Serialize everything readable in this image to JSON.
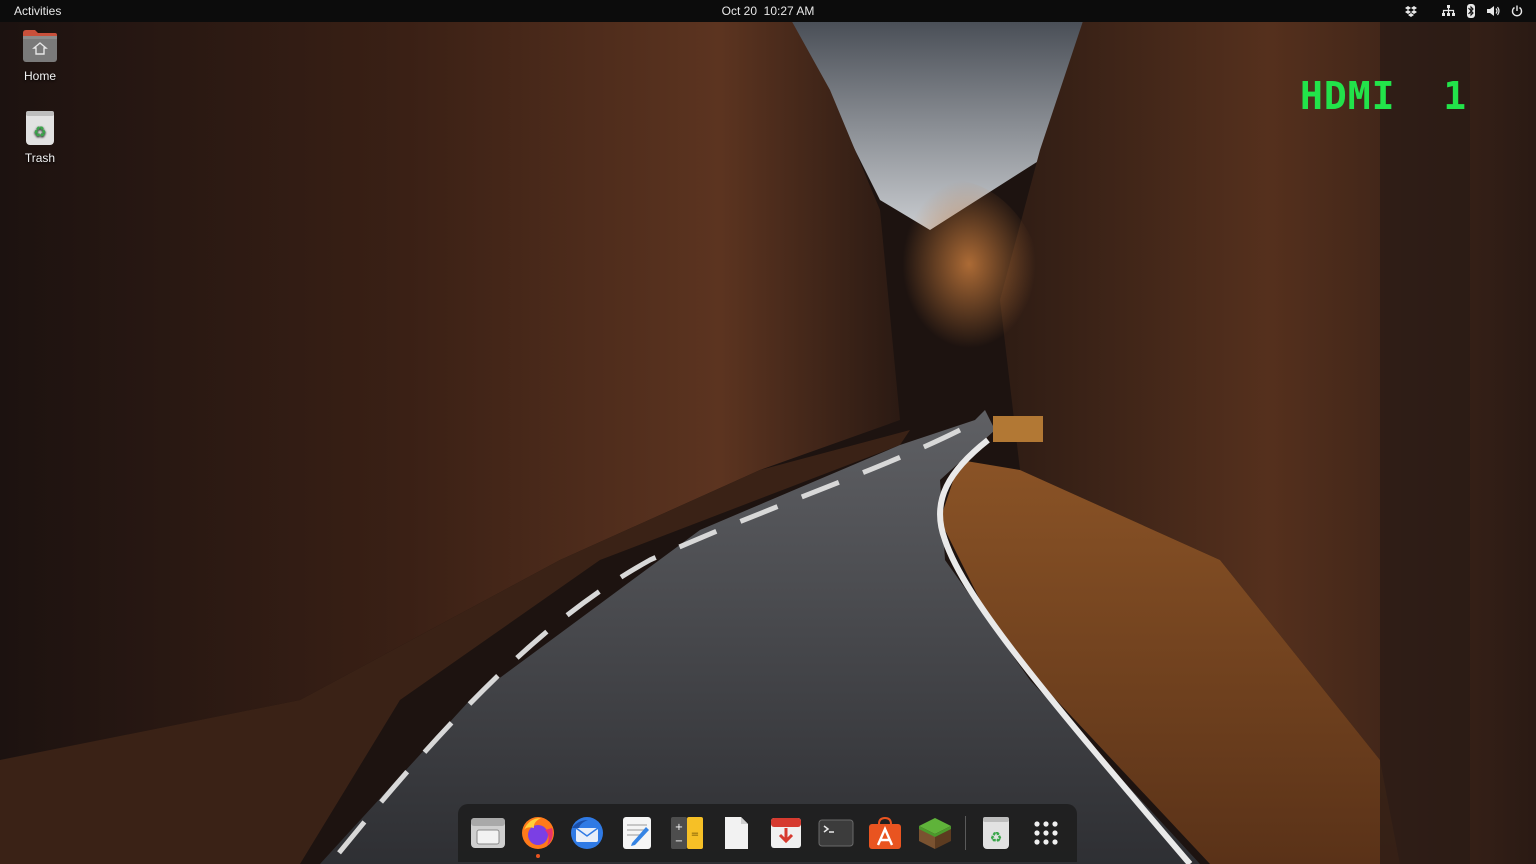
{
  "topbar": {
    "activities_label": "Activities",
    "clock": "Oct 20  10:27 AM",
    "tray_icons": [
      "dropbox-icon",
      "network-icon",
      "bluetooth-icon",
      "volume-icon",
      "power-icon"
    ]
  },
  "desktop": {
    "icons": [
      {
        "label": "Home",
        "icon": "home-folder-icon"
      },
      {
        "label": "Trash",
        "icon": "trash-icon"
      }
    ]
  },
  "overlay": {
    "hdmi_text": "HDMI  1",
    "color": "#22e34a"
  },
  "dock": {
    "items": [
      {
        "icon": "files-icon",
        "running": false
      },
      {
        "icon": "firefox-icon",
        "running": true
      },
      {
        "icon": "thunderbird-icon",
        "running": false
      },
      {
        "icon": "text-editor-icon",
        "running": false
      },
      {
        "icon": "calculator-icon",
        "running": false
      },
      {
        "icon": "document-viewer-icon",
        "running": false
      },
      {
        "icon": "software-updater-icon",
        "running": false
      },
      {
        "icon": "terminal-icon",
        "running": false
      },
      {
        "icon": "app-center-icon",
        "running": false
      },
      {
        "icon": "minecraft-icon",
        "running": false
      },
      {
        "icon": "trash-icon",
        "running": false
      },
      {
        "icon": "show-apps-grid-icon",
        "running": false
      }
    ],
    "accent": "#e95420"
  }
}
